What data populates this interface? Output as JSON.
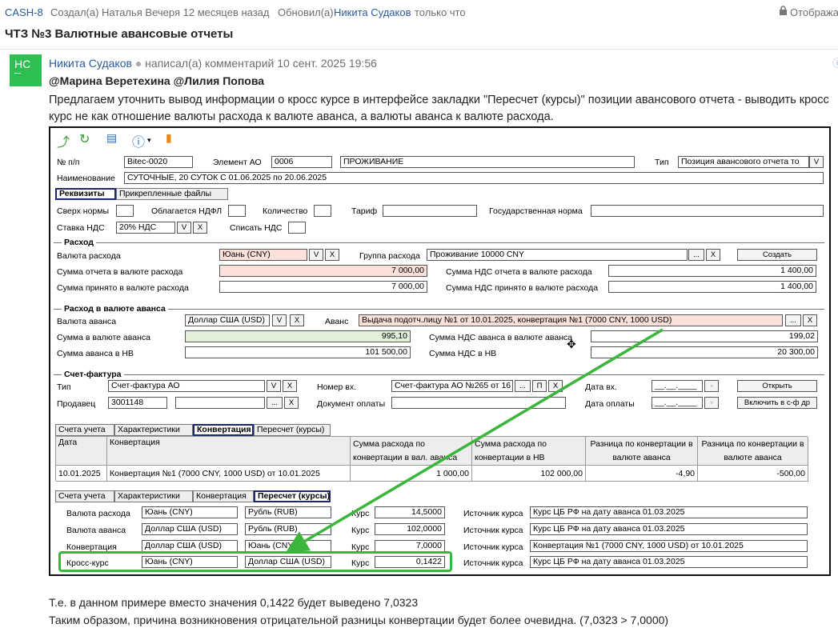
{
  "header": {
    "issue_key": "CASH-8",
    "created_prefix": "Создал(а) Наталья Вечеря 12 месяцев назад",
    "updated_prefix": "Обновил(а)",
    "updated_by": "Никита Судаков",
    "updated_when": "только что",
    "visibility_label": "Отобража",
    "title": "ЧТЗ №3 Валютные авансовые отчеты"
  },
  "comment": {
    "avatar_initials": "НС",
    "author": "Никита Судаков",
    "action": "написал(а) комментарий 10 сент. 2025 19:56",
    "mentions": "@Марина Веретехина @Лилия Попова",
    "body": "Предлагаем уточнить вывод информации о кросс курсе в интерфейсе закладки \"Пересчет (курсы)\" позиции авансового отчета - выводить кросс курс не как отношение валюты расхода к валюте аванса, а валюты аванса к валюте расхода."
  },
  "form": {
    "no_label": "№ п/п",
    "no_value": "Bitec-0020",
    "element_label": "Элемент АО",
    "element_code": "0006",
    "element_name": "ПРОЖИВАНИЕ",
    "type_label": "Тип",
    "type_value": "Позиция авансового отчета то",
    "name_label": "Наименование",
    "name_value": "СУТОЧНЫЕ, 20 СУТОК С 01.06.2025 по 20.06.2025",
    "tabs_top": [
      "Реквизиты",
      "Прикрепленные файлы"
    ],
    "over_norm": "Сверх нормы",
    "ndfl": "Облагается НДФЛ",
    "qty": "Количество",
    "tariff": "Тариф",
    "gov_norm": "Государственная норма",
    "vat_rate_label": "Ставка НДС",
    "vat_rate_value": "20% НДС",
    "write_off_vat": "Списать НДС",
    "expense": {
      "title": "Расход",
      "currency_label": "Валюта расхода",
      "currency_value": "Юань (CNY)",
      "group_label": "Группа расхода",
      "group_value": "Проживание 10000 CNY",
      "create_btn": "Создать",
      "sum_report_label": "Сумма отчета в валюте расхода",
      "sum_report_value": "7 000,00",
      "vat_report_label": "Сумма НДС отчета в валюте расхода",
      "vat_report_value": "1 400,00",
      "sum_accepted_label": "Сумма принято в валюте расхода",
      "sum_accepted_value": "7 000,00",
      "vat_accepted_label": "Сумма НДС принято в валюте расхода",
      "vat_accepted_value": "1 400,00"
    },
    "advance": {
      "title": "Расход в валюте аванса",
      "currency_label": "Валюта аванса",
      "currency_value": "Доллар США (USD)",
      "adv_label": "Аванс",
      "adv_value": "Выдача подотч.лицу №1 от 10.01.2025, конвертация №1 (7000 CNY, 1000 USD)",
      "sum_label": "Сумма в валюте аванса",
      "sum_value": "995,10",
      "vat_label": "Сумма НДС аванса в валюте аванса",
      "vat_value": "199,02",
      "sum_nv_label": "Сумма аванса в НВ",
      "sum_nv_value": "101 500,00",
      "vat_nv_label": "Сумма НДС в НВ",
      "vat_nv_value": "20 300,00"
    },
    "invoice": {
      "title": "Счет-фактура",
      "type_label": "Тип",
      "type_value": "Счет-фактура АО",
      "in_no_label": "Номер вх.",
      "in_no_value": "Счет-фактура АО №265 от 16",
      "in_date_label": "Дата вх.",
      "in_date_value": "__.__.____",
      "open_btn": "Открыть",
      "seller_label": "Продавец",
      "seller_value": "3001148",
      "pay_doc_label": "Документ оплаты",
      "pay_date_label": "Дата оплаты",
      "pay_date_value": "__.__.____",
      "include_btn": "Включить в с-ф др"
    },
    "btn": {
      "v": "V",
      "x": "X",
      "dots": "...",
      "p": "П"
    },
    "tabs_bottom": [
      "Счета учета",
      "Характеристики",
      "Конвертация",
      "Пересчет (курсы)"
    ],
    "conversion_table": {
      "headers": [
        "Дата",
        "Конвертация",
        "Сумма расхода по конвертации в вал. аванса",
        "Сумма расхода по конвертации в НВ",
        "Разница по конвертации в валюте аванса",
        "Разница по конвертации в валюте аванса"
      ],
      "row": [
        "10.01.2025",
        "Конвертация №1 (7000 CNY, 1000 USD) от 10.01.2025",
        "1 000,00",
        "102 000,00",
        "-4,90",
        "-500,00"
      ]
    },
    "rates": {
      "rate_label": "Курс",
      "source_label": "Источник курса",
      "rows": [
        {
          "label": "Валюта расхода",
          "c1": "Юань (CNY)",
          "c2": "Рубль (RUB)",
          "rate": "14,5000",
          "source": "Курс ЦБ РФ на дату аванса 01.03.2025"
        },
        {
          "label": "Валюта аванса",
          "c1": "Доллар США (USD)",
          "c2": "Рубль (RUB)",
          "rate": "102,0000",
          "source": "Курс ЦБ РФ на дату аванса 01.03.2025"
        },
        {
          "label": "Конвертация",
          "c1": "Доллар США (USD)",
          "c2": "Юань (CNY",
          "rate": "7,0000",
          "source": "Конвертация №1 (7000 CNY, 1000 USD) от 10.01.2025"
        },
        {
          "label": "Кросс-курс",
          "c1": "Юань (CNY)",
          "c2": "Доллар США (USD)",
          "rate": "0,1422",
          "source": "Курс ЦБ РФ на дату аванса 01.03.2025"
        }
      ]
    }
  },
  "footer": {
    "line1": "Т.е. в данном примере вместо значения 0,1422 будет выведено 7,0323",
    "line2": "Таким образом, причина возникновения отрицательной разницы конвертации будет более очевидна. (7,0323 > 7,0000)"
  },
  "colors": {
    "accent": "#2a5a9c",
    "avatar": "#2fbe52",
    "highlight": "#3bb53b",
    "pink_field": "#fbe1d9",
    "green_field": "#e3f0da"
  }
}
